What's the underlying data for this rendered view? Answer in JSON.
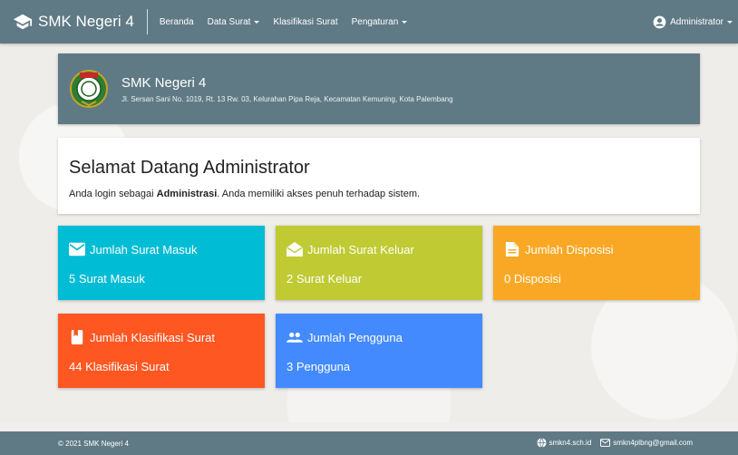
{
  "navbar": {
    "brand": "SMK Negeri 4",
    "items": [
      {
        "label": "Beranda",
        "dropdown": false
      },
      {
        "label": "Data Surat",
        "dropdown": true
      },
      {
        "label": "Klasifikasi Surat",
        "dropdown": false
      },
      {
        "label": "Pengaturan",
        "dropdown": true
      }
    ],
    "user": "Administrator"
  },
  "school": {
    "name": "SMK Negeri 4",
    "address": "Jl. Sersan Sani No. 1019, Rt. 13 Rw. 03, Kelurahan Pipa Reja, Kecamatan Kemuning, Kota Palembang"
  },
  "welcome": {
    "title": "Selamat Datang Administrator",
    "prefix": "Anda login sebagai ",
    "role": "Administrasi",
    "suffix": ". Anda memiliki akses penuh terhadap sistem."
  },
  "stats": [
    {
      "title": "Jumlah Surat Masuk",
      "value": "5 Surat Masuk",
      "icon": "envelope-icon",
      "color": "#00bcd4"
    },
    {
      "title": "Jumlah Surat Keluar",
      "value": "2 Surat Keluar",
      "icon": "envelope-open-icon",
      "color": "#c0ca33"
    },
    {
      "title": "Jumlah Disposisi",
      "value": "0 Disposisi",
      "icon": "document-icon",
      "color": "#f9a825"
    },
    {
      "title": "Jumlah Klasifikasi Surat",
      "value": "44 Klasifikasi Surat",
      "icon": "bookmark-icon",
      "color": "#ff5722"
    },
    {
      "title": "Jumlah Pengguna",
      "value": "3 Pengguna",
      "icon": "people-icon",
      "color": "#448aff"
    }
  ],
  "footer": {
    "copyright": "© 2021 SMK Negeri 4",
    "website": "smkn4.sch.id",
    "email": "smkn4plbng@gmail.com"
  },
  "colors": {
    "primary": "#5f7a85"
  }
}
